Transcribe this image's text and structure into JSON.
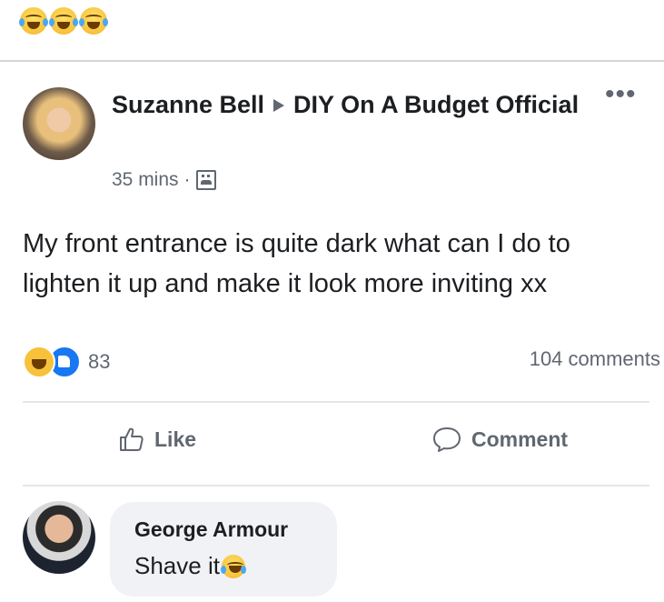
{
  "top_emojis": [
    "laughing-crying-emoji",
    "laughing-crying-emoji",
    "laughing-crying-emoji"
  ],
  "post": {
    "author": "Suzanne Bell",
    "group": "DIY On A Budget Official",
    "time": "35 mins",
    "separator": "·",
    "more_icon": "•••",
    "text": "My front entrance is quite dark what can I do to lighten it up and make it look more inviting xx"
  },
  "engagement": {
    "reaction_count": "83",
    "comment_count": "104 comments"
  },
  "actions": {
    "like_label": "Like",
    "comment_label": "Comment"
  },
  "comment": {
    "author": "George Armour",
    "text": "Shave it"
  },
  "colors": {
    "like_blue": "#1877f2",
    "meta_gray": "#606770",
    "bubble_bg": "#f0f2f5"
  }
}
